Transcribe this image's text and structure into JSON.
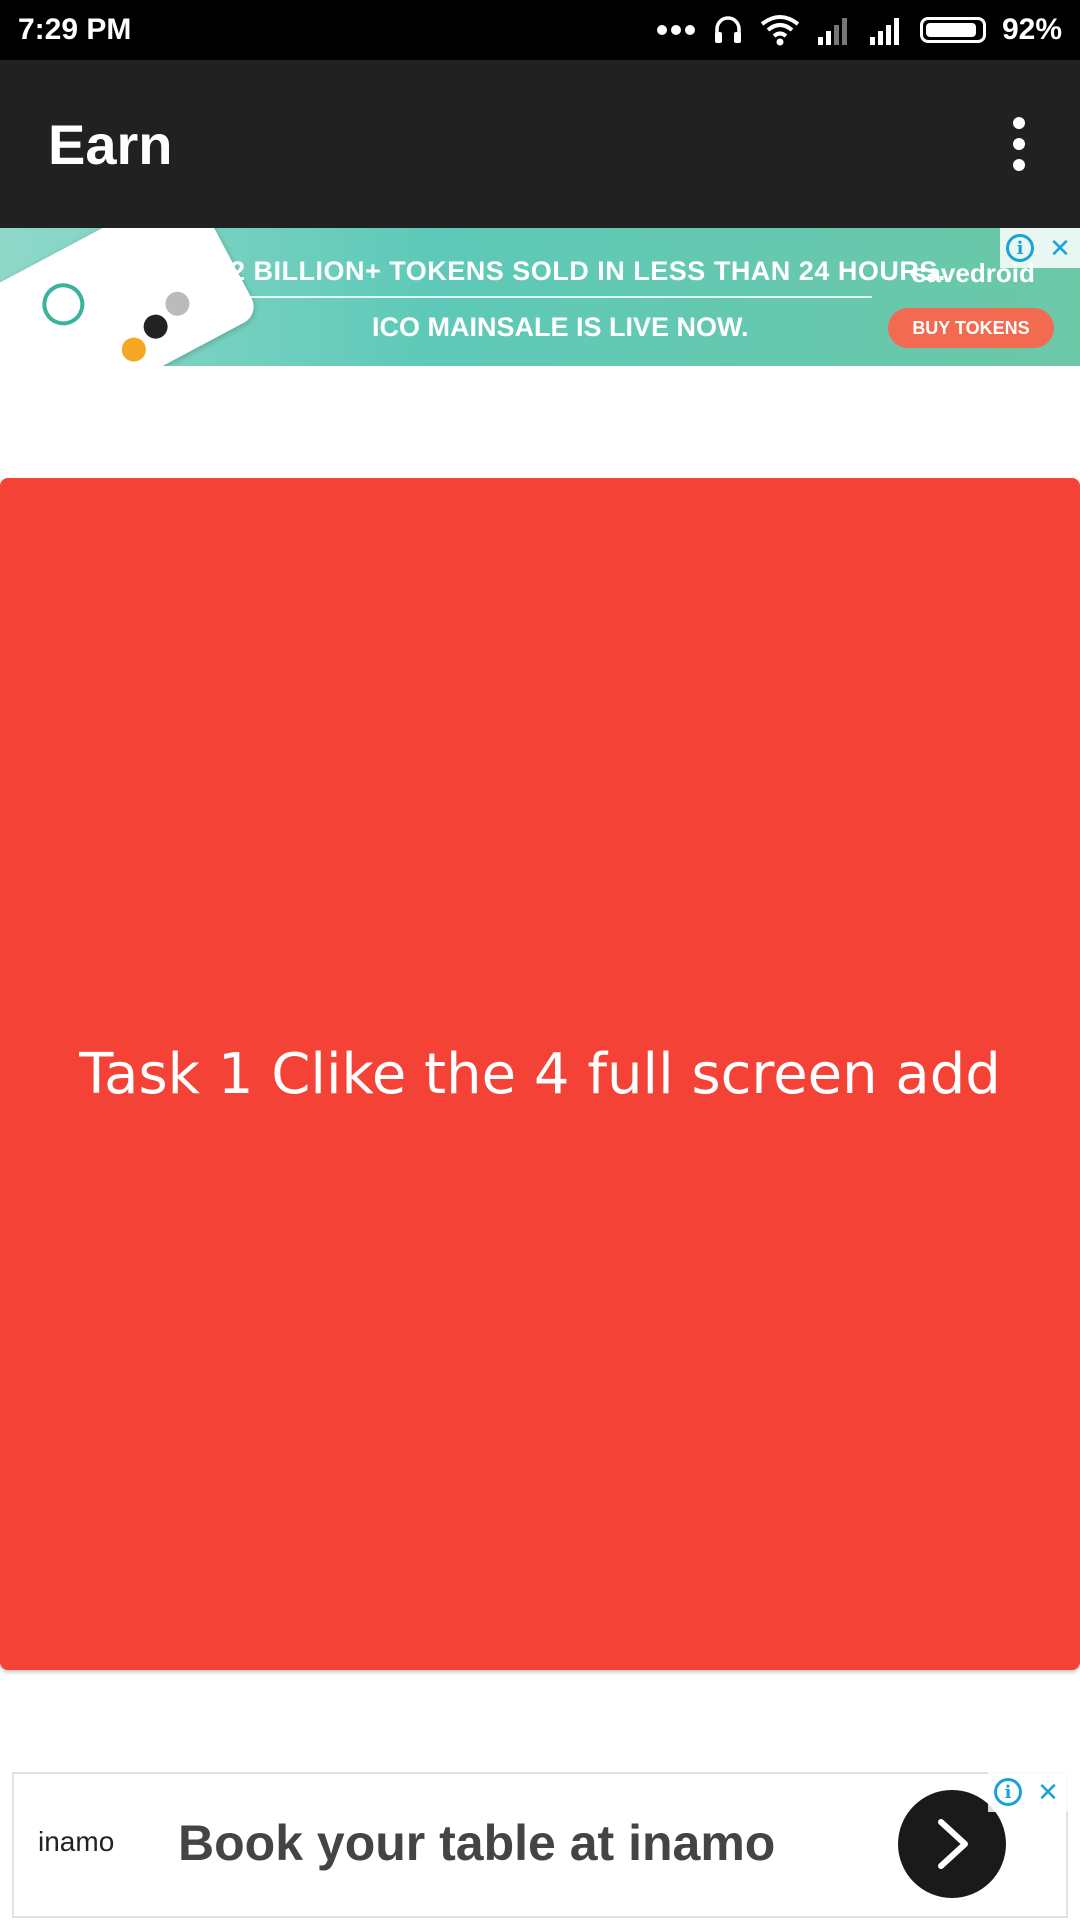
{
  "status_bar": {
    "time": "7:29 PM",
    "battery": "92%",
    "battery_level": 0.92
  },
  "app_bar": {
    "title": "Earn",
    "overflow_icon": "more-vert-icon"
  },
  "top_ad": {
    "headline": "2 BILLION+ TOKENS SOLD IN LESS THAN 24 HOURS.",
    "subline": "ICO MAINSALE IS LIVE NOW.",
    "brand": "savedroid",
    "cta": "BUY TOKENS",
    "accent_color": "#f26a4f"
  },
  "task_card": {
    "text": "Task 1 Clike the 4 full screen add",
    "color": "#f44336"
  },
  "bottom_ad": {
    "brand": "inamo",
    "headline": "Book your table at inamo"
  },
  "colors": {
    "status_bar": "#000000",
    "app_bar": "#212121",
    "ad_info": "#1aa3d9"
  }
}
